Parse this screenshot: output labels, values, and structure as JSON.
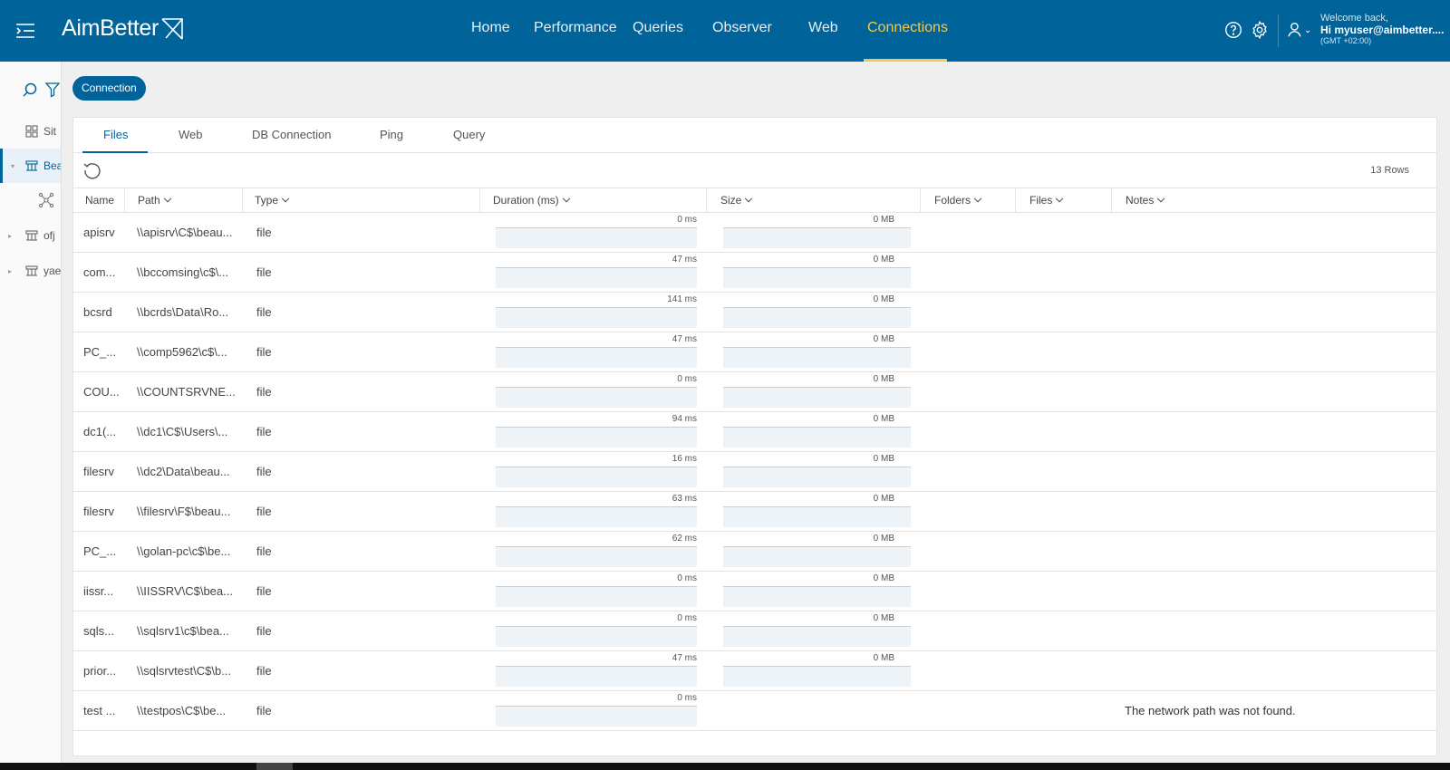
{
  "app": {
    "logo": "AimBetter",
    "nav": [
      {
        "label": "Home",
        "active": false
      },
      {
        "label": "Performance",
        "active": false
      },
      {
        "label": "Queries",
        "active": false
      },
      {
        "label": "Observer",
        "active": false
      },
      {
        "label": "Web",
        "active": false
      },
      {
        "label": "Connections",
        "active": true
      }
    ],
    "user": {
      "welcome": "Welcome back,",
      "name": "Hi myuser@aimbetter....",
      "timezone": "(GMT +02:00)"
    },
    "icons": [
      "menu-icon",
      "help-icon",
      "gear-icon",
      "user-icon",
      "search-icon",
      "filter-icon",
      "refresh-icon",
      "grid-icon",
      "server-icon",
      "network-icon"
    ],
    "colors": {
      "header": "#00639a",
      "accent": "#f7c948"
    }
  },
  "sidebar": {
    "items": [
      {
        "label": "Sit",
        "icon": "grid-icon",
        "caret": "",
        "active": false
      },
      {
        "label": "Bea",
        "icon": "server-icon",
        "caret": "▾",
        "active": true
      },
      {
        "label": "",
        "icon": "network-icon",
        "caret": "",
        "active": false
      },
      {
        "label": "ofj",
        "icon": "server-icon",
        "caret": "▸",
        "active": false
      },
      {
        "label": "yae",
        "icon": "server-icon",
        "caret": "▸",
        "active": false
      }
    ]
  },
  "chip": {
    "label": "Connection"
  },
  "tabs": [
    {
      "label": "Files",
      "active": true
    },
    {
      "label": "Web",
      "active": false
    },
    {
      "label": "DB Connection",
      "active": false
    },
    {
      "label": "Ping",
      "active": false
    },
    {
      "label": "Query",
      "active": false
    }
  ],
  "table": {
    "rows_count": "13 Rows",
    "columns": [
      "Name",
      "Path",
      "Type",
      "Duration (ms)",
      "Size",
      "Folders",
      "Files",
      "Notes"
    ],
    "rows": [
      {
        "name": "apisrv",
        "path": "\\\\apisrv\\C$\\beau...",
        "type": "file",
        "duration": "0 ms",
        "size": "0 MB",
        "notes": ""
      },
      {
        "name": "com...",
        "path": "\\\\bccomsing\\c$\\...",
        "type": "file",
        "duration": "47 ms",
        "size": "0 MB",
        "notes": ""
      },
      {
        "name": "bcsrd",
        "path": "\\\\bcrds\\Data\\Ro...",
        "type": "file",
        "duration": "141 ms",
        "size": "0 MB",
        "notes": ""
      },
      {
        "name": "PC_...",
        "path": "\\\\comp5962\\c$\\...",
        "type": "file",
        "duration": "47 ms",
        "size": "0 MB",
        "notes": ""
      },
      {
        "name": "COU...",
        "path": "\\\\COUNTSRVNE...",
        "type": "file",
        "duration": "0 ms",
        "size": "0 MB",
        "notes": ""
      },
      {
        "name": "dc1(...",
        "path": "\\\\dc1\\C$\\Users\\...",
        "type": "file",
        "duration": "94 ms",
        "size": "0 MB",
        "notes": ""
      },
      {
        "name": "filesrv",
        "path": "\\\\dc2\\Data\\beau...",
        "type": "file",
        "duration": "16 ms",
        "size": "0 MB",
        "notes": ""
      },
      {
        "name": "filesrv",
        "path": "\\\\filesrv\\F$\\beau...",
        "type": "file",
        "duration": "63 ms",
        "size": "0 MB",
        "notes": ""
      },
      {
        "name": "PC_...",
        "path": "\\\\golan-pc\\c$\\be...",
        "type": "file",
        "duration": "62 ms",
        "size": "0 MB",
        "notes": ""
      },
      {
        "name": "iissr...",
        "path": "\\\\IISSRV\\C$\\bea...",
        "type": "file",
        "duration": "0 ms",
        "size": "0 MB",
        "notes": ""
      },
      {
        "name": "sqls...",
        "path": "\\\\sqlsrv1\\c$\\bea...",
        "type": "file",
        "duration": "0 ms",
        "size": "0 MB",
        "notes": ""
      },
      {
        "name": "prior...",
        "path": "\\\\sqlsrvtest\\C$\\b...",
        "type": "file",
        "duration": "47 ms",
        "size": "0 MB",
        "notes": ""
      },
      {
        "name": "test ...",
        "path": "\\\\testpos\\C$\\be...",
        "type": "file",
        "duration": "0 ms",
        "size": "",
        "notes": "The network path was not found."
      }
    ]
  }
}
